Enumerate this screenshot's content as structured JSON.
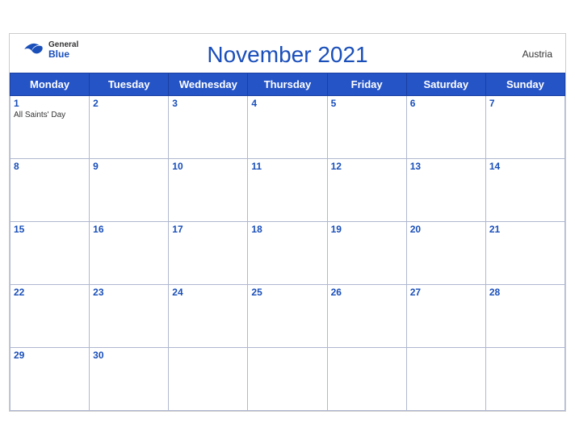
{
  "header": {
    "title": "November 2021",
    "country": "Austria",
    "logo": {
      "general": "General",
      "blue": "Blue"
    }
  },
  "weekdays": [
    "Monday",
    "Tuesday",
    "Wednesday",
    "Thursday",
    "Friday",
    "Saturday",
    "Sunday"
  ],
  "weeks": [
    [
      {
        "day": "1",
        "event": "All Saints' Day"
      },
      {
        "day": "2",
        "event": ""
      },
      {
        "day": "3",
        "event": ""
      },
      {
        "day": "4",
        "event": ""
      },
      {
        "day": "5",
        "event": ""
      },
      {
        "day": "6",
        "event": ""
      },
      {
        "day": "7",
        "event": ""
      }
    ],
    [
      {
        "day": "8",
        "event": ""
      },
      {
        "day": "9",
        "event": ""
      },
      {
        "day": "10",
        "event": ""
      },
      {
        "day": "11",
        "event": ""
      },
      {
        "day": "12",
        "event": ""
      },
      {
        "day": "13",
        "event": ""
      },
      {
        "day": "14",
        "event": ""
      }
    ],
    [
      {
        "day": "15",
        "event": ""
      },
      {
        "day": "16",
        "event": ""
      },
      {
        "day": "17",
        "event": ""
      },
      {
        "day": "18",
        "event": ""
      },
      {
        "day": "19",
        "event": ""
      },
      {
        "day": "20",
        "event": ""
      },
      {
        "day": "21",
        "event": ""
      }
    ],
    [
      {
        "day": "22",
        "event": ""
      },
      {
        "day": "23",
        "event": ""
      },
      {
        "day": "24",
        "event": ""
      },
      {
        "day": "25",
        "event": ""
      },
      {
        "day": "26",
        "event": ""
      },
      {
        "day": "27",
        "event": ""
      },
      {
        "day": "28",
        "event": ""
      }
    ],
    [
      {
        "day": "29",
        "event": ""
      },
      {
        "day": "30",
        "event": ""
      },
      {
        "day": "",
        "event": ""
      },
      {
        "day": "",
        "event": ""
      },
      {
        "day": "",
        "event": ""
      },
      {
        "day": "",
        "event": ""
      },
      {
        "day": "",
        "event": ""
      }
    ]
  ],
  "colors": {
    "header_bg": "#2554c7",
    "title_color": "#1a4fba",
    "day_number_color": "#1a4fba"
  }
}
